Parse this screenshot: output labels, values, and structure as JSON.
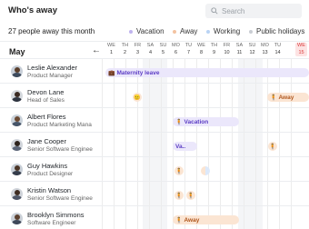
{
  "header": {
    "title": "Who's away",
    "search_placeholder": "Search"
  },
  "summary": "27 people away this month",
  "legend": [
    {
      "label": "Vacation",
      "color": "#bfb3ee"
    },
    {
      "label": "Away",
      "color": "#f3c3a1"
    },
    {
      "label": "Working",
      "color": "#b9d3f4"
    },
    {
      "label": "Public holidays",
      "color": "#c9cdd3"
    }
  ],
  "calendar": {
    "month": "May",
    "prev_arrow": "←",
    "days": [
      {
        "dow": "WE",
        "num": "1"
      },
      {
        "dow": "TH",
        "num": "2"
      },
      {
        "dow": "FR",
        "num": "3"
      },
      {
        "dow": "SA",
        "num": "4"
      },
      {
        "dow": "SU",
        "num": "5"
      },
      {
        "dow": "MO",
        "num": "6"
      },
      {
        "dow": "TU",
        "num": "7"
      },
      {
        "dow": "WE",
        "num": "8"
      },
      {
        "dow": "TH",
        "num": "9"
      },
      {
        "dow": "FR",
        "num": "10"
      },
      {
        "dow": "SA",
        "num": "11"
      },
      {
        "dow": "SU",
        "num": "12"
      },
      {
        "dow": "MO",
        "num": "13"
      },
      {
        "dow": "TU",
        "num": "14"
      },
      {
        "dow": "WE",
        "num": "15"
      }
    ]
  },
  "people": [
    {
      "name": "Leslie Alexander",
      "role": "Product Manager"
    },
    {
      "name": "Devon Lane",
      "role": "Head of Sales"
    },
    {
      "name": "Albert Flores",
      "role": "Product Marketing Mana"
    },
    {
      "name": "Jane Cooper",
      "role": "Senior Software Enginee"
    },
    {
      "name": "Guy Hawkins",
      "role": "Product Designer"
    },
    {
      "name": "Kristin Watson",
      "role": "Senior Software Enginee"
    },
    {
      "name": "Brooklyn Simmons",
      "role": "Software Engineer"
    }
  ],
  "events": {
    "maternity_leave": "Maternity leave",
    "devon_away": "Away",
    "albert_vacation": "Vacation",
    "jane_vacation": "Va..",
    "brooklyn_away": "Away"
  }
}
